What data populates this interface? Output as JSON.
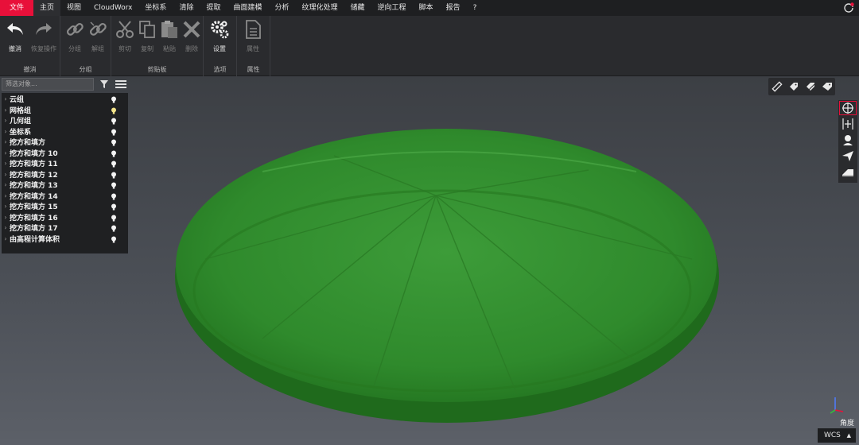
{
  "menu": {
    "items": [
      "文件",
      "主页",
      "视图",
      "CloudWorx",
      "坐标系",
      "清除",
      "提取",
      "曲面建模",
      "分析",
      "纹理化处理",
      "储藏",
      "逆向工程",
      "脚本",
      "报告",
      "?"
    ]
  },
  "ribbon": {
    "undo": {
      "label": "撤消",
      "sub": "恢复操作",
      "group": "撤消"
    },
    "grouping": {
      "group_label": "分组",
      "group_btn": "分组",
      "ungroup_btn": "解组"
    },
    "clipboard": {
      "group_label": "剪贴板",
      "cut": "剪切",
      "copy": "复制",
      "paste": "粘贴",
      "delete": "删除"
    },
    "options": {
      "group_label": "选项",
      "settings": "设置"
    },
    "properties": {
      "group_label": "属性",
      "props": "属性"
    }
  },
  "panel": {
    "filter_placeholder": "筛选对象...",
    "tree": [
      {
        "label": "云组",
        "bulb": "white"
      },
      {
        "label": "网格组",
        "bulb": "yellow"
      },
      {
        "label": "几何组",
        "bulb": "white"
      },
      {
        "label": "坐标系",
        "bulb": "white"
      },
      {
        "label": "挖方和填方",
        "bulb": "white"
      },
      {
        "label": "挖方和填方 10",
        "bulb": "white"
      },
      {
        "label": "挖方和填方 11",
        "bulb": "white"
      },
      {
        "label": "挖方和填方 12",
        "bulb": "white"
      },
      {
        "label": "挖方和填方 13",
        "bulb": "white"
      },
      {
        "label": "挖方和填方 14",
        "bulb": "white"
      },
      {
        "label": "挖方和填方 15",
        "bulb": "white"
      },
      {
        "label": "挖方和填方 16",
        "bulb": "white"
      },
      {
        "label": "挖方和填方 17",
        "bulb": "white"
      },
      {
        "label": "由高程计算体积",
        "bulb": "white"
      }
    ]
  },
  "viewport": {
    "angle_label": "角度",
    "wcs_label": "WCS",
    "mesh_color": "#2e8a2c"
  },
  "colors": {
    "accent": "#e8103a",
    "menubar": "#1e1f21",
    "ribbon": "#2a2b2e"
  }
}
